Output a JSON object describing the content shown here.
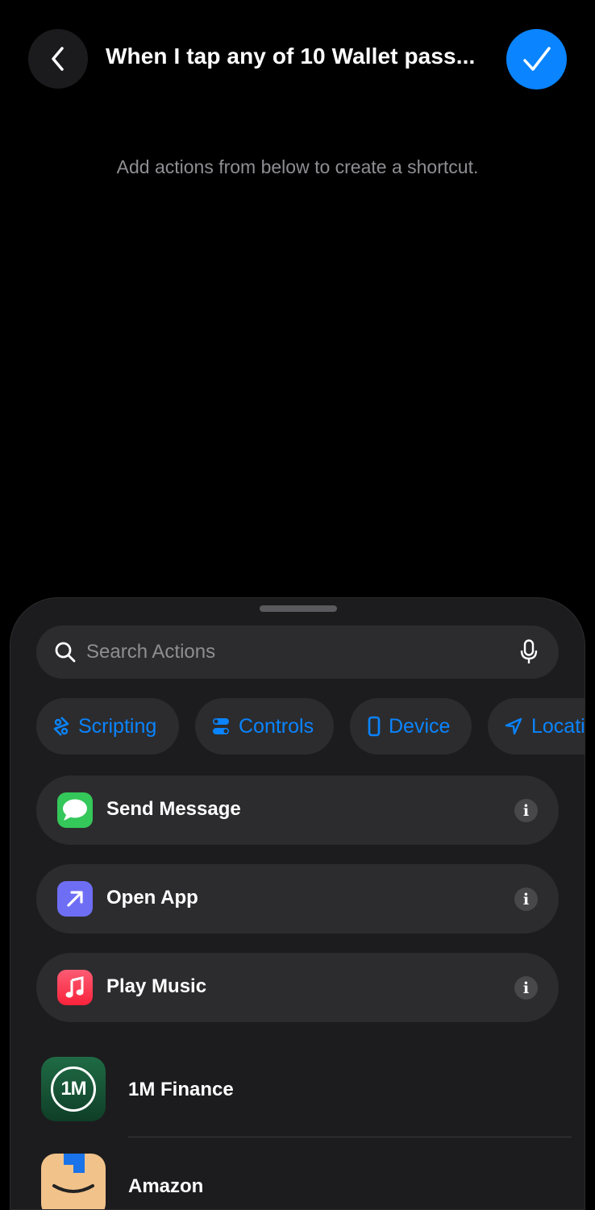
{
  "header": {
    "title": "When I tap any of 10 Wallet pass...",
    "back_icon": "chevron-left-icon",
    "done_icon": "checkmark-icon",
    "accent_color": "#0a84ff"
  },
  "main": {
    "hint": "Add actions from below to create a shortcut."
  },
  "sheet": {
    "search": {
      "placeholder": "Search Actions"
    },
    "categories": [
      {
        "label": "Scripting",
        "icon": "scripting-icon"
      },
      {
        "label": "Controls",
        "icon": "controls-toggle-icon"
      },
      {
        "label": "Device",
        "icon": "device-phone-icon"
      },
      {
        "label": "Locati",
        "icon": "location-arrow-icon"
      }
    ],
    "suggestions": [
      {
        "label": "Send Message",
        "icon": "messages-app-icon",
        "color": "#34c759"
      },
      {
        "label": "Open App",
        "icon": "open-app-arrow-icon",
        "color": "#6e6ef5"
      },
      {
        "label": "Play Music",
        "icon": "music-note-icon",
        "color": "#fa2d48"
      }
    ],
    "apps": [
      {
        "name": "1M Finance",
        "icon": "1m-finance-logo",
        "logo_text": "1M"
      },
      {
        "name": "Amazon",
        "icon": "amazon-logo"
      }
    ]
  }
}
